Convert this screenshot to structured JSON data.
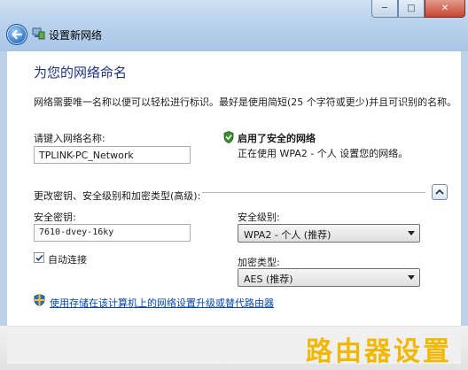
{
  "window": {
    "title": "设置新网络",
    "controls": {
      "minimize": "─",
      "maximize": "□",
      "close": "✕"
    }
  },
  "page": {
    "heading": "为您的网络命名",
    "description": "网络需要唯一名称以便可以轻松进行标识。最好是使用简短(25 个字符或更少)并且可识别的名称。"
  },
  "network_name": {
    "label": "请键入网络名称:",
    "value": "TPLINK-PC_Network"
  },
  "security_status": {
    "title": "启用了安全的网络",
    "detail": "正在使用 WPA2 - 个人 设置您的网络。"
  },
  "advanced": {
    "label": "更改密钥、安全级别和加密类型(高级):"
  },
  "security_key": {
    "label": "安全密钥:",
    "value": "7610-dvey-16ky"
  },
  "security_level": {
    "label": "安全级别:",
    "selected": "WPA2 - 个人 (推荐)"
  },
  "auto_connect": {
    "label": "自动连接",
    "checked": true
  },
  "encryption_type": {
    "label": "加密类型:",
    "selected": "AES (推荐)"
  },
  "upgrade_link": "使用存储在该计算机上的网络设置升级或替代路由器",
  "watermark": "路由器设置",
  "colors": {
    "heading": "#1e3287",
    "link": "#0645ad",
    "shield_green": "#3a8f2e",
    "watermark": "#f2b800"
  }
}
